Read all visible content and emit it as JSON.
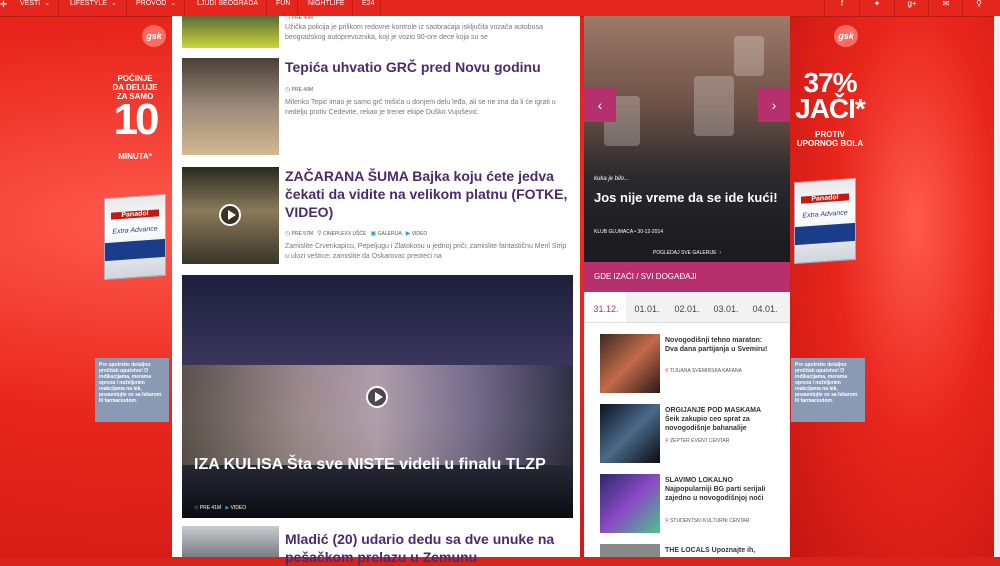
{
  "nav": {
    "items": [
      {
        "label": "VESTI",
        "has_caret": true
      },
      {
        "label": "LIFESTYLE",
        "has_caret": true
      },
      {
        "label": "PROVOD",
        "has_caret": true
      },
      {
        "label": "LJUDI BEOGRADA",
        "has_caret": false
      },
      {
        "label": "FUN",
        "has_caret": false
      },
      {
        "label": "NIGHTLIFE",
        "has_caret": false
      },
      {
        "label": "E24",
        "has_caret": false
      }
    ],
    "social_icons": [
      "facebook-icon",
      "twitter-icon",
      "google-plus-icon",
      "mail-icon",
      "search-icon"
    ]
  },
  "left_ad": {
    "logo": "gsk",
    "line1": "POČINJE",
    "line2": "DA DELUJE",
    "line3": "ZA SAMO",
    "big": "10",
    "small": "MINUTA*",
    "box_brand": "Panadol",
    "box_sub": "Extra Advance",
    "info": "Pre upotrebe detaljno pročitati uputstvo! O indikacijama, merama opreza i neželjenim reakcijama na lek, posavetujte se sa lekarom ili farmaceutom."
  },
  "right_ad": {
    "logo": "gsk",
    "big": "37% JAČI*",
    "sub": "PROTIV UPORNOG BOLA",
    "box_brand": "Panadol",
    "box_sub": "Extra Advance",
    "info": "Pre upotrebe detaljno pročitati uputstvo! O indikacijama, merama opreza i neželjenim reakcijama na lek, posavetujte se sa lekarom ili farmaceutom."
  },
  "articles": [
    {
      "title": "",
      "meta_time": "PRE 40M",
      "excerpt": "Užička policija je prilikom redovne kontrole iz saobraćaja isključila vozača autobusa beogradskog autoprevoznika, koji je vozio 90-ore dece koja su se"
    },
    {
      "title": "Tepića uhvatio GRČ pred Novu godinu",
      "meta_time": "PRE 49M",
      "excerpt": "Milenko Tepić imao je samo grč mišića u donjem delu leđa, ali se ne zna da li će igrati u nedelju protiv Cedevite, rekao je trener ekipe Duško Vujošević."
    },
    {
      "title": "ZAČARANA ŠUMA Bajka koju ćete jedva čekati da vidite na velikom platnu (FOTKE, VIDEO)",
      "meta_time": "PRE 57M",
      "meta_place": "CINEPLEXX UŠĆE",
      "meta_gallery": "GALERIJA",
      "meta_video": "VIDEO",
      "excerpt": "Zamislite Crvenkapicu, Pepeljugu i Zlatokosu u jednoj priči; zamislite fantastičnu Meril Strip u ulozi veštice; zamislite da Oskarovac preoteći na"
    }
  ],
  "feature": {
    "title": "IZA KULISA Šta sve NISTE videli u finalu TLZP",
    "meta_time": "PRE 41M",
    "meta_video": "VIDEO"
  },
  "bottom_article": {
    "title": "Mladić (20) udario dedu sa dve unuke na pešačkom prelazu u Zemunu"
  },
  "slider": {
    "kicker": "kuka je bilo...",
    "title": "Jos nije vreme da se ide kući!",
    "meta": "KLUB GLUMACA • 30-12-2014",
    "gallery_link": "POGLEDAJ SVE GALERIJE"
  },
  "events": {
    "header": "GDE IZAĆI / SVI DOGAĐAJI",
    "dates": [
      "31.12.",
      "01.01.",
      "02.01.",
      "03.01.",
      "04.01."
    ],
    "active_date_index": 0,
    "items": [
      {
        "title": "Novogodišnji tehno maraton: Dva dana partijanja u Svemiru!",
        "place": "TIJUANA SVEMIRSKA KAFANA"
      },
      {
        "title": "ORGIJANJE POD MASKAMA Šeik zakupio ceo sprat za novogodišnje bahanalije",
        "place": "ZEPTER EVENT CENTAR"
      },
      {
        "title": "SLAVIMO LOKALNO Najpopularniji BG parti serijali zajedno u novogodišnjoj noći",
        "place": "STUDENTSKI KULTURNI CENTAR"
      },
      {
        "title": "THE LOCALS Upoznajte ih,",
        "place": ""
      }
    ]
  }
}
